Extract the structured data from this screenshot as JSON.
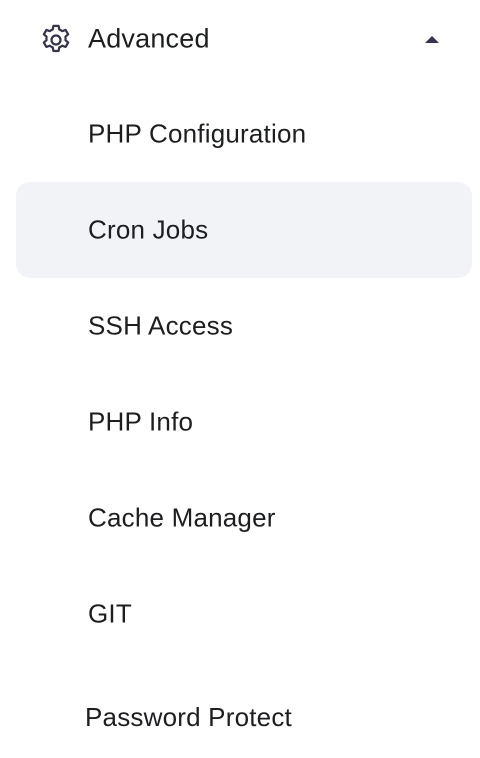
{
  "section": {
    "title": "Advanced",
    "icon": "gear-icon",
    "chevron": "chevron-up-icon",
    "expanded": true
  },
  "menu": {
    "items": [
      {
        "label": "PHP Configuration",
        "active": false
      },
      {
        "label": "Cron Jobs",
        "active": true
      },
      {
        "label": "SSH Access",
        "active": false
      },
      {
        "label": "PHP Info",
        "active": false
      },
      {
        "label": "Cache Manager",
        "active": false
      },
      {
        "label": "GIT",
        "active": false
      },
      {
        "label": "Password Protect",
        "active": false
      }
    ]
  },
  "colors": {
    "text": "#1d1e20",
    "icon": "#36344d",
    "active_background": "#f2f3f6",
    "background": "#ffffff"
  }
}
